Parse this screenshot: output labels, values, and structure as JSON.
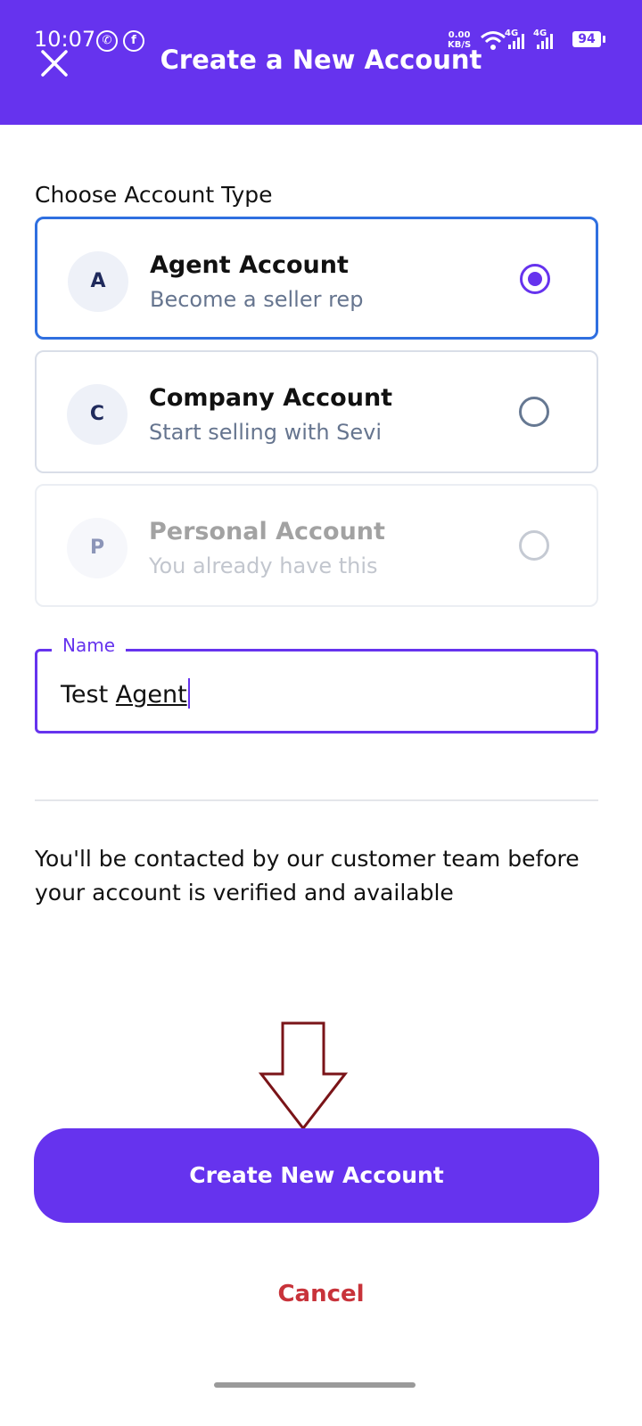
{
  "status_bar": {
    "time": "10:07",
    "net_speed_value": "0.00",
    "net_speed_unit": "KB/S",
    "signal1_label": "4G",
    "signal2_label": "4G",
    "battery": "94",
    "app_icons": [
      "whatsapp-icon",
      "facebook-icon"
    ]
  },
  "header": {
    "title": "Create a New Account",
    "close_icon": "close-icon",
    "background_color": "#6633EE"
  },
  "account_type": {
    "label": "Choose Account Type",
    "options": [
      {
        "letter": "A",
        "title": "Agent Account",
        "subtitle": "Become a seller rep",
        "selected": true,
        "enabled": true
      },
      {
        "letter": "C",
        "title": "Company Account",
        "subtitle": "Start selling with Sevi",
        "selected": false,
        "enabled": true
      },
      {
        "letter": "P",
        "title": "Personal Account",
        "subtitle": "You already have this",
        "selected": false,
        "enabled": false
      }
    ]
  },
  "name_field": {
    "label": "Name",
    "value_first": "Test",
    "value_second": "Agent"
  },
  "info": {
    "text": "You'll be contacted by our customer team before your account is verified and available"
  },
  "actions": {
    "create_label": "Create New Account",
    "cancel_label": "Cancel"
  },
  "colors": {
    "accent": "#6633EE",
    "selected_border": "#2F6FE0",
    "cancel": "#C8333A",
    "annotation_arrow": "#7A1418"
  }
}
